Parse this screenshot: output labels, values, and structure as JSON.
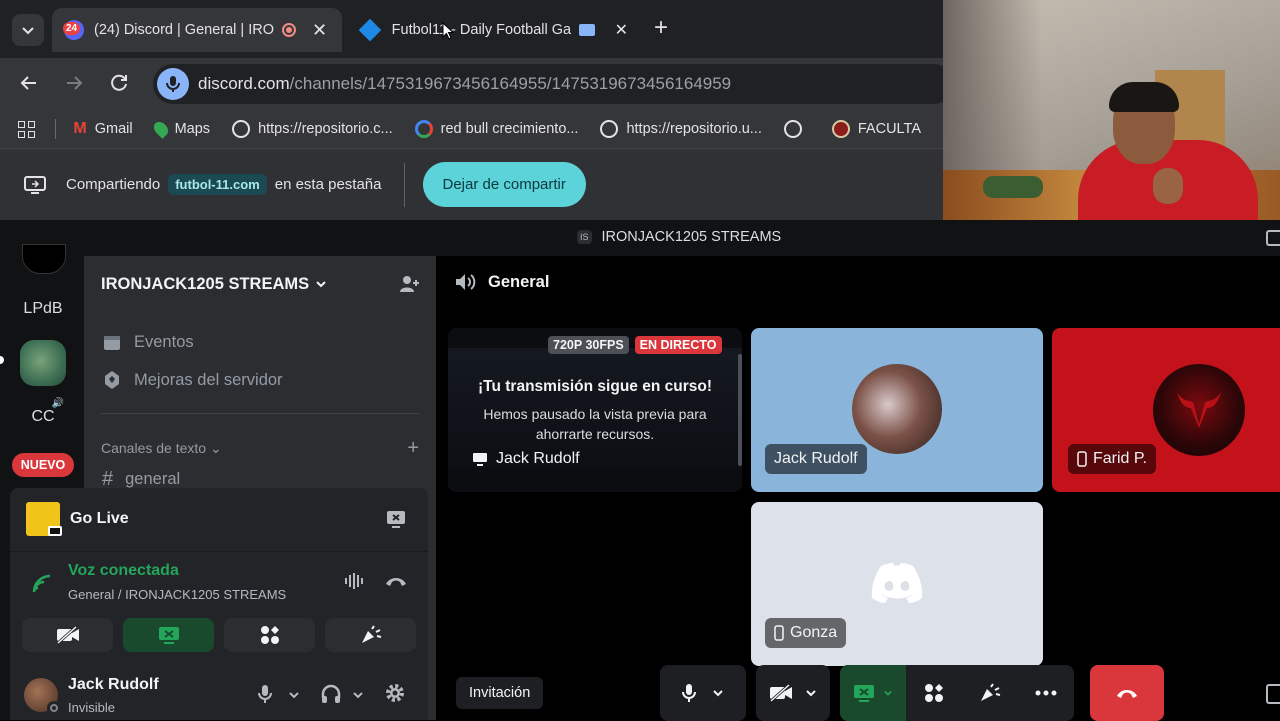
{
  "browser": {
    "tabs": [
      {
        "title": "(24) Discord | General | IRON",
        "badge": "24"
      },
      {
        "title": "Futbol11 - Daily Football Ga"
      }
    ],
    "url_domain": "discord.com",
    "url_path": "/channels/1475319673456164955/1475319673456164959",
    "bookmarks": [
      "Gmail",
      "Maps",
      "https://repositorio.c...",
      "red bull crecimiento...",
      "https://repositorio.u...",
      "",
      "FACULTA"
    ],
    "share": {
      "prefix": "Compartiendo",
      "site": "futbol-11.com",
      "suffix": "en esta pestaña",
      "stop_label": "Dejar de compartir"
    }
  },
  "discord": {
    "window_title": "IRONJACK1205 STREAMS",
    "window_title_icon": "IS",
    "guilds": [
      "LPdB",
      "CC",
      "NUEVO"
    ],
    "server": {
      "name": "IRONJACK1205 STREAMS",
      "events_label": "Eventos",
      "boosts_label": "Mejoras del servidor",
      "category_label": "Canales de texto",
      "channel_general": "general"
    },
    "golive": {
      "title": "Go Live"
    },
    "voice": {
      "status": "Voz conectada",
      "location": "General / IRONJACK1205 STREAMS"
    },
    "user": {
      "name": "Jack Rudolf",
      "status": "Invisible"
    },
    "channel_header": "General",
    "stream_tile": {
      "quality": "720P 30FPS",
      "live": "EN DIRECTO",
      "title": "¡Tu transmisión sigue en curso!",
      "body": "Hemos pausado la vista previa para ahorrarte recursos.",
      "name": "Jack Rudolf"
    },
    "participants": [
      "Jack Rudolf",
      "Farid P.",
      "Gonza"
    ],
    "invite_label": "Invitación"
  },
  "colors": {
    "accent_green": "#23a55a",
    "danger_red": "#da373c",
    "share_button": "#5cd2d9",
    "nuevo_red": "#da373c",
    "jack_tile": "#8ab4d9",
    "farid_tile": "#c4121a",
    "gonza_tile": "#dde2ea"
  }
}
